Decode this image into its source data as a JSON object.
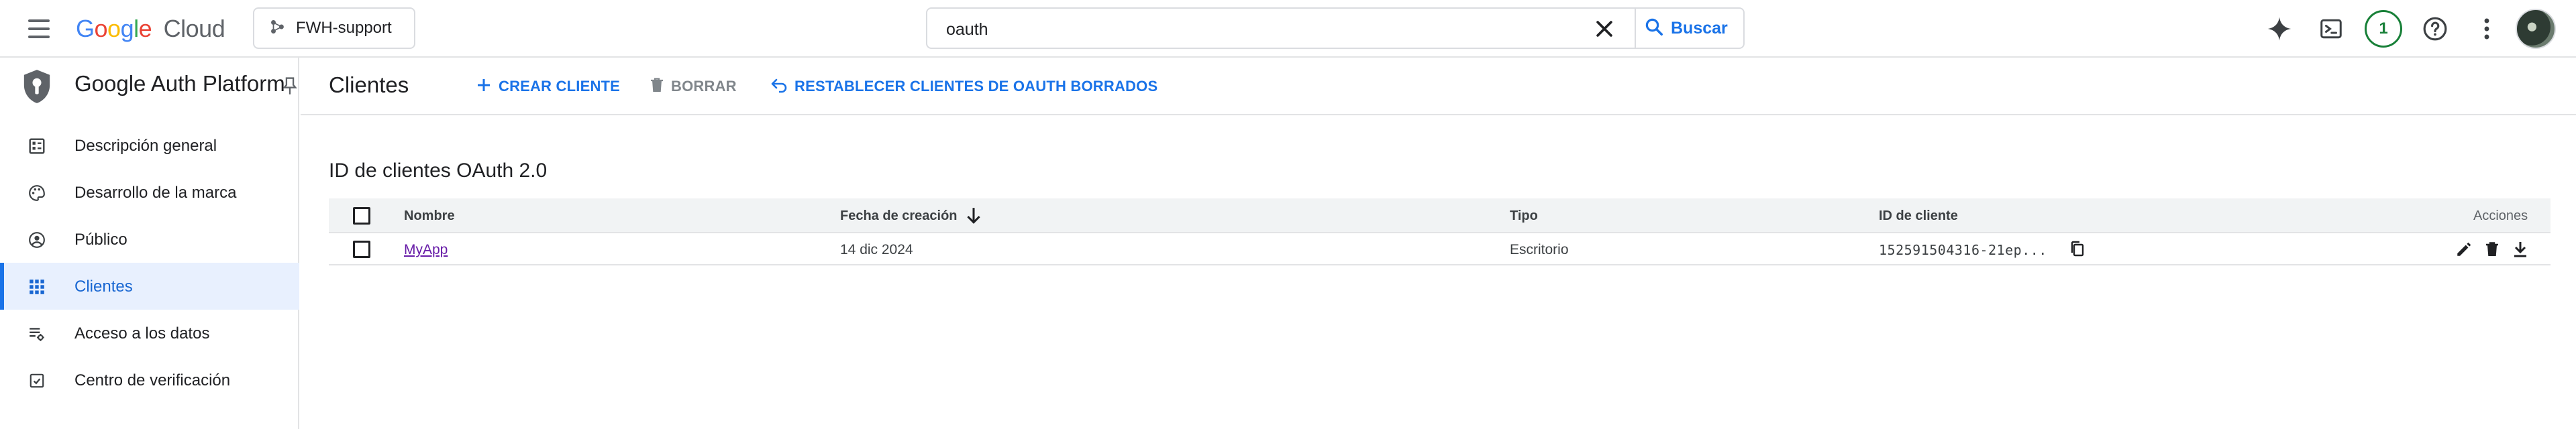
{
  "header": {
    "logo_google": "Google",
    "logo_cloud": "Cloud",
    "project": "FWH-support",
    "search_value": "oauth",
    "search_button": "Buscar",
    "notifications_count": "1"
  },
  "sidebar": {
    "product_title": "Google Auth Platform",
    "items": [
      {
        "label": "Descripción general",
        "icon": "dashboard-icon"
      },
      {
        "label": "Desarrollo de la marca",
        "icon": "palette-icon"
      },
      {
        "label": "Público",
        "icon": "person-icon"
      },
      {
        "label": "Clientes",
        "icon": "apps-icon",
        "active": true
      },
      {
        "label": "Acceso a los datos",
        "icon": "data-access-icon"
      },
      {
        "label": "Centro de verificación",
        "icon": "verified-icon"
      }
    ]
  },
  "main": {
    "page_title": "Clientes",
    "actions": {
      "create": "CREAR CLIENTE",
      "delete": "BORRAR",
      "restore": "RESTABLECER CLIENTES DE OAUTH BORRADOS"
    },
    "section_title": "ID de clientes OAuth 2.0",
    "table": {
      "columns": {
        "name": "Nombre",
        "created": "Fecha de creación",
        "type": "Tipo",
        "client_id": "ID de cliente",
        "actions": "Acciones"
      },
      "rows": [
        {
          "name": "MyApp",
          "created": "14 dic 2024",
          "type": "Escritorio",
          "client_id": "152591504316-21ep..."
        }
      ]
    }
  },
  "colors": {
    "accent": "#1a73e8",
    "active_bg": "#e8f0fe",
    "link_visited": "#681da8",
    "badge_green": "#188038"
  }
}
